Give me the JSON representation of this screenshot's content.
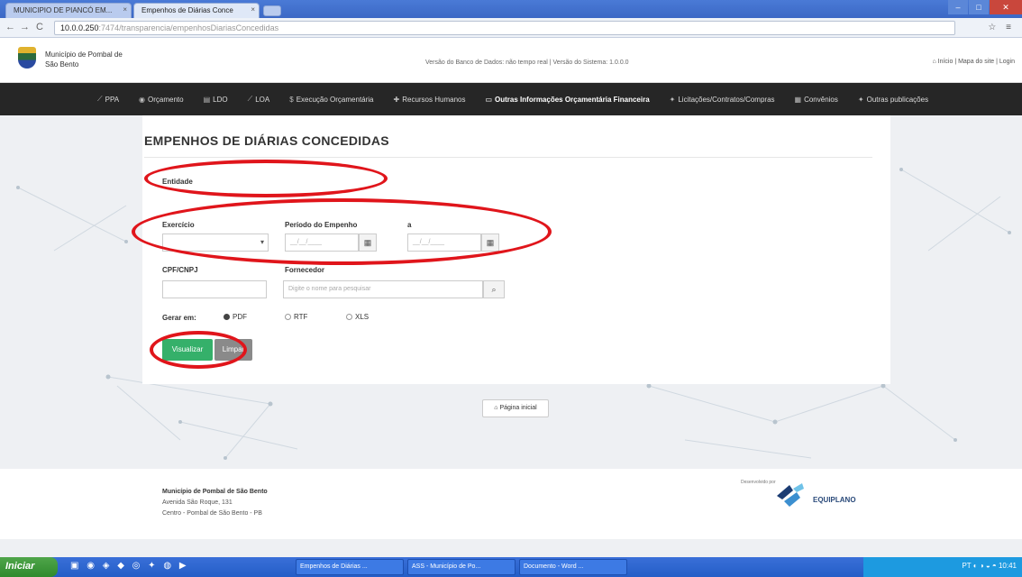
{
  "browser": {
    "tabs": [
      {
        "label": "MUNICIPIO DE PIANCÓ EM..."
      },
      {
        "label": "Empenhos de Diárias Conce"
      }
    ],
    "url_host": "10.0.0.250",
    "url_path": ":7474/transparencia/empenhosDiariasConcedidas",
    "right_icons": "☆ ≡"
  },
  "header": {
    "municipality": "Município de Pombal de São Bento",
    "versions": "Versão do Banco de Dados: não tempo real  |  Versão do Sistema: 1.0.0.0",
    "links": "⌂ Início  |  Mapa do site  |  Login"
  },
  "nav": {
    "items": [
      {
        "icon": "⟋",
        "label": "PPA"
      },
      {
        "icon": "◉",
        "label": "Orçamento"
      },
      {
        "icon": "▤",
        "label": "LDO"
      },
      {
        "icon": "⟋",
        "label": "LOA"
      },
      {
        "icon": "$",
        "label": "Execução Orçamentária"
      },
      {
        "icon": "✚",
        "label": "Recursos Humanos"
      },
      {
        "icon": "▭",
        "label": "Outras Informações Orçamentária Financeira"
      },
      {
        "icon": "✦",
        "label": "Licitações/Contratos/Compras"
      },
      {
        "icon": "▦",
        "label": "Convênios"
      },
      {
        "icon": "✦",
        "label": "Outras publicações"
      }
    ]
  },
  "form": {
    "title": "EMPENHOS DE DIÁRIAS CONCEDIDAS",
    "entidade_label": "Entidade",
    "exercicio_label": "Exercício",
    "periodo_label": "Período do Empenho",
    "a_label": "a",
    "date_placeholder": "__/__/____",
    "cpf_label": "CPF/CNPJ",
    "fornecedor_label": "Fornecedor",
    "fornecedor_placeholder": "Digite o nome para pesquisar",
    "gerar_label": "Gerar em:",
    "formats": [
      "PDF",
      "RTF",
      "XLS"
    ],
    "selected_format": "PDF",
    "view_button": "Visualizar",
    "clear_button": "Limpar"
  },
  "home_button": "⌂ Página inicial",
  "footer": {
    "name": "Município de Pombal de São Bento",
    "address": "Avenida São Roque, 131",
    "city": "Centro - Pombal de São Bento - PB",
    "dev_by": "Desenvolvido por",
    "brand": "EQUIPLANO"
  },
  "taskbar": {
    "start": "Iniciar",
    "tasks": [
      "Empenhos de Diárias ...",
      "ASS - Município de Po...",
      "Documento - Word ..."
    ],
    "tray": "PT  ◐ ◑ ◒ ◓ 10:41"
  },
  "colors": {
    "nav_bg": "#262626",
    "view_button": "#35b06a",
    "annotation": "#e0151b"
  }
}
